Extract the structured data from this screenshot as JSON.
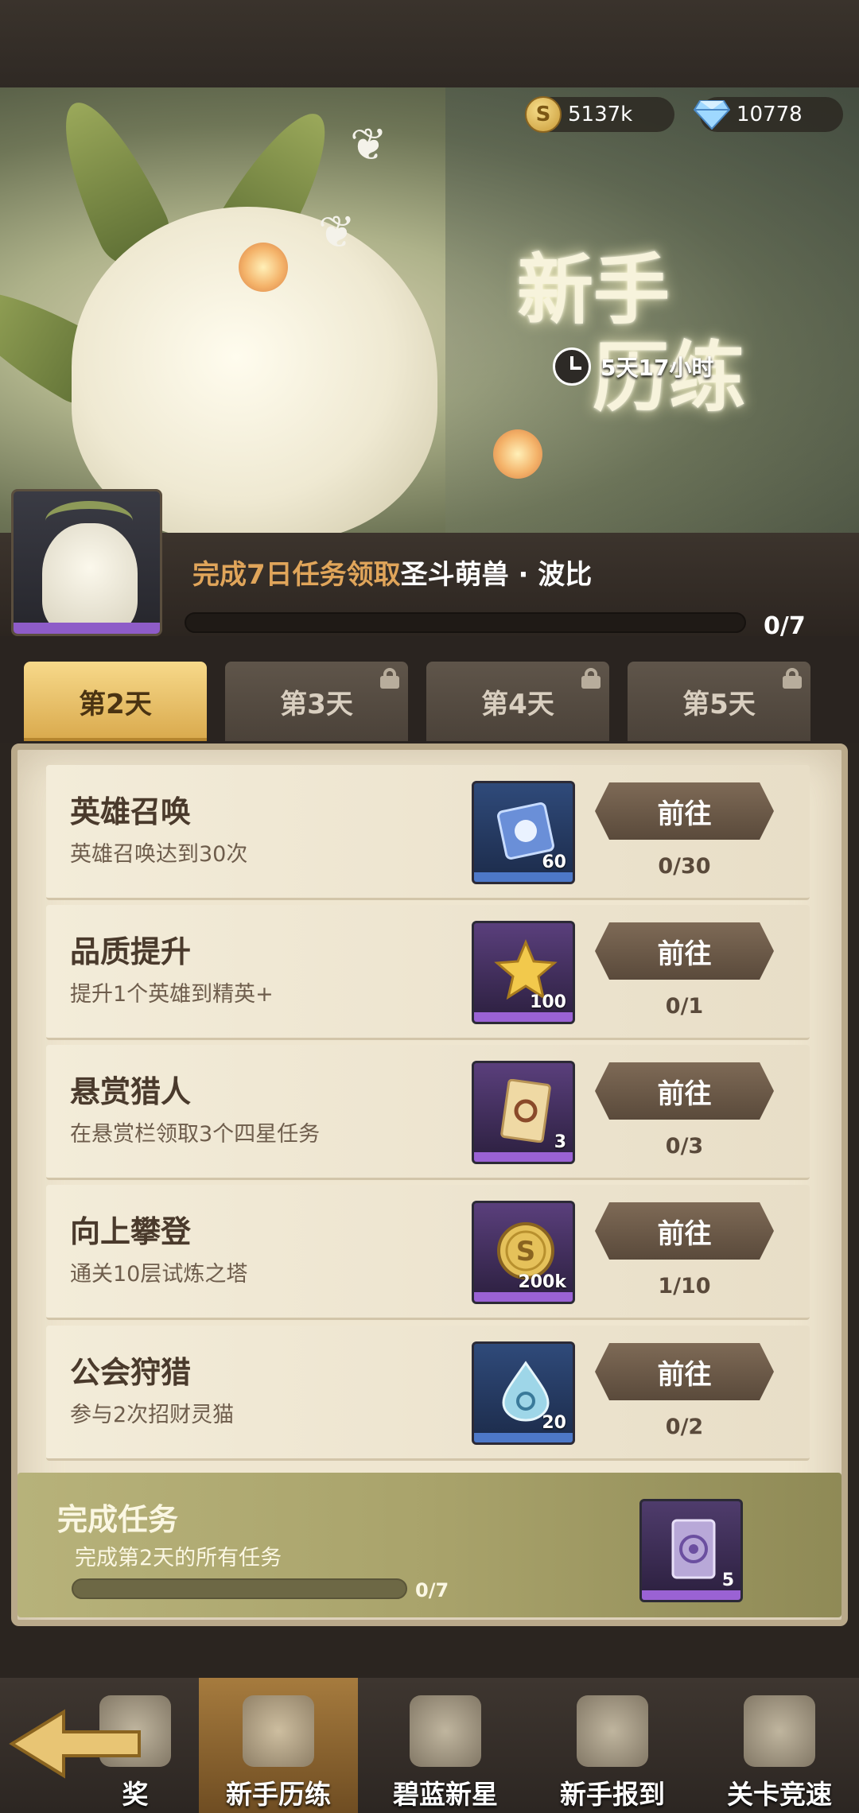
{
  "currency": {
    "gold": "5137k",
    "gems": "10778",
    "gold_symbol": "S"
  },
  "banner": {
    "title_line1": "新手",
    "title_line2": "历练",
    "timer": "5天17小时"
  },
  "reward": {
    "text_prefix": "完成7日任务领取",
    "text_highlight": "圣斗萌兽 · 波比",
    "progress": "0/7",
    "progress_fraction": 0
  },
  "tabs": [
    {
      "label": "第2天",
      "active": true,
      "locked": false
    },
    {
      "label": "第3天",
      "active": false,
      "locked": true
    },
    {
      "label": "第4天",
      "active": false,
      "locked": true
    },
    {
      "label": "第5天",
      "active": false,
      "locked": true
    }
  ],
  "tasks": [
    {
      "title": "英雄召唤",
      "desc": "英雄召唤达到30次",
      "button": "前往",
      "progress": "0/30",
      "item_qty": "60",
      "item_icon": "summon-scroll-icon"
    },
    {
      "title": "品质提升",
      "desc": "提升1个英雄到精英+",
      "button": "前往",
      "progress": "0/1",
      "item_qty": "100",
      "item_icon": "star-icon"
    },
    {
      "title": "悬赏猎人",
      "desc": "在悬赏栏领取3个四星任务",
      "button": "前往",
      "progress": "0/3",
      "item_qty": "3",
      "item_icon": "bounty-ticket-icon"
    },
    {
      "title": "向上攀登",
      "desc": "通关10层试炼之塔",
      "button": "前往",
      "progress": "1/10",
      "item_qty": "200k",
      "item_icon": "gold-coin-icon"
    },
    {
      "title": "公会狩猎",
      "desc": "参与2次招财灵猫",
      "button": "前往",
      "progress": "0/2",
      "item_qty": "20",
      "item_icon": "water-drop-icon"
    }
  ],
  "complete": {
    "title": "完成任务",
    "desc": "完成第2天的所有任务",
    "progress": "0/7",
    "progress_fraction": 0,
    "item_qty": "5",
    "item_icon": "magic-card-icon"
  },
  "nav": [
    {
      "label": "奖",
      "active": false
    },
    {
      "label": "新手历练",
      "active": true
    },
    {
      "label": "碧蓝新星",
      "active": false
    },
    {
      "label": "新手报到",
      "active": false
    },
    {
      "label": "关卡竞速",
      "active": false
    }
  ]
}
